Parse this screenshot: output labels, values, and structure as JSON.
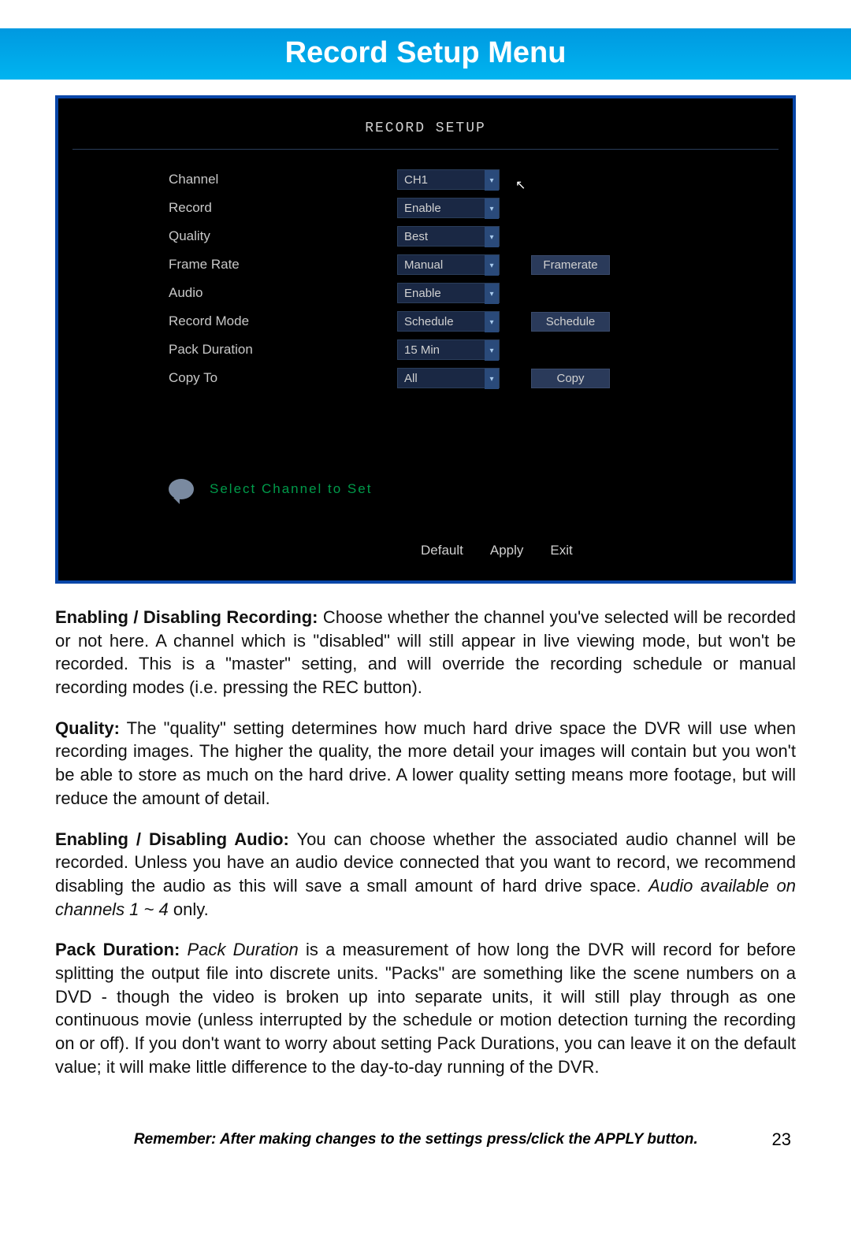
{
  "header": {
    "title": "Record Setup Menu"
  },
  "dvr": {
    "title": "RECORD SETUP",
    "rows": [
      {
        "label": "Channel",
        "value": "CH1",
        "button": ""
      },
      {
        "label": "Record",
        "value": "Enable",
        "button": ""
      },
      {
        "label": "Quality",
        "value": "Best",
        "button": ""
      },
      {
        "label": "Frame  Rate",
        "value": "Manual",
        "button": "Framerate"
      },
      {
        "label": "Audio",
        "value": "Enable",
        "button": ""
      },
      {
        "label": "Record  Mode",
        "value": "Schedule",
        "button": "Schedule"
      },
      {
        "label": "Pack  Duration",
        "value": "15  Min",
        "button": ""
      },
      {
        "label": "Copy  To",
        "value": "All",
        "button": "Copy"
      }
    ],
    "hint": "Select  Channel  to  Set",
    "bottom": {
      "default_": "Default",
      "apply": "Apply",
      "exit": "Exit"
    }
  },
  "doc": {
    "p1_strong": "Enabling / Disabling Recording:",
    "p1_body": " Choose whether the channel you've selected will be recorded or not here. A channel which is \"disabled\" will still appear in live viewing mode, but won't be recorded. This is a \"master\" setting, and will override the recording schedule or manual recording modes (i.e. pressing the REC button).",
    "p2_strong": "Quality:",
    "p2_body": " The \"quality\" setting determines how much hard drive space the DVR will use when recording images. The higher the quality, the more detail your images will contain but you won't be able to store as much on the hard drive. A lower quality setting means more footage, but will reduce the amount of detail.",
    "p3_strong": "Enabling / Disabling Audio:",
    "p3_body_a": " You can choose whether the associated audio channel will be recorded. Unless you have an audio device connected that you want to record, we recommend disabling the audio as this will save a small amount of hard drive space. ",
    "p3_em": "Audio available on channels 1 ~ 4 ",
    "p3_body_b": "only.",
    "p4_strong": "Pack Duration:",
    "p4_em": " Pack Duration",
    "p4_body": " is a measurement of how long the DVR will record for before splitting the output file into discrete units. \"Packs\" are something like the scene numbers on a DVD - though the video is broken up into separate units, it will still play through as one continuous movie (unless interrupted by the schedule or motion detection turning the recording on or off). If you don't want to worry about setting Pack Durations, you can leave it on the default value; it will make little difference to the day-to-day running of the DVR."
  },
  "footer": {
    "reminder": "Remember: After making changes to the settings press/click the APPLY button.",
    "page": "23"
  }
}
